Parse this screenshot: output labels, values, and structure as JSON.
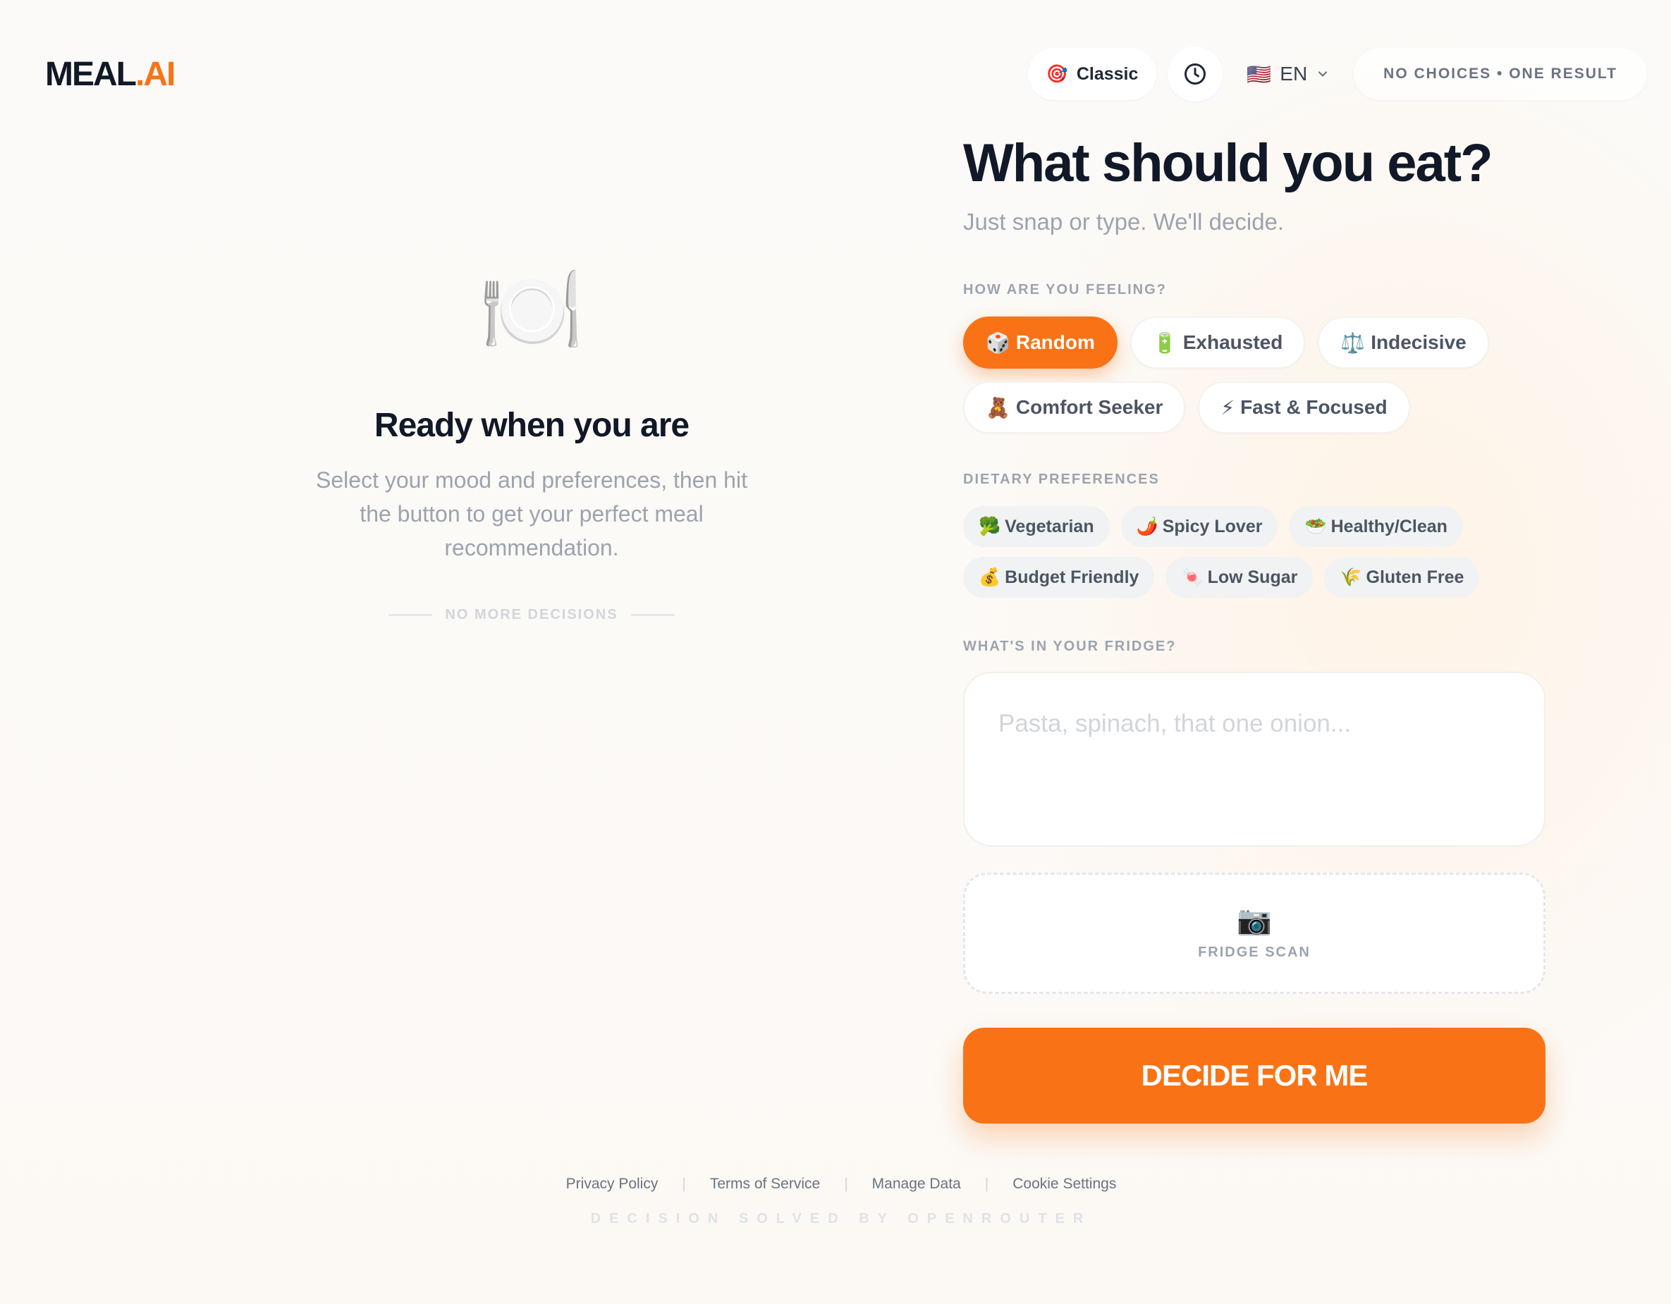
{
  "brand": {
    "name_main": "MEAL",
    "name_dot_ai": ".AI"
  },
  "header": {
    "mode": {
      "icon": "🎯",
      "label": "Classic"
    },
    "history_icon": "clock-icon",
    "language": {
      "flag": "🇺🇸",
      "code": "EN"
    },
    "tagline": "NO CHOICES • ONE RESULT"
  },
  "empty_state": {
    "icon": "🍽️",
    "title": "Ready when you are",
    "description": "Select your mood and preferences, then hit the button to get your perfect meal recommendation.",
    "divider_text": "NO MORE DECISIONS"
  },
  "form": {
    "title": "What should you eat?",
    "subtitle": "Just snap or type. We'll decide.",
    "mood_label": "HOW ARE YOU FEELING?",
    "moods": [
      {
        "icon": "🎲",
        "label": "Random",
        "selected": true
      },
      {
        "icon": "🔋",
        "label": "Exhausted",
        "selected": false
      },
      {
        "icon": "⚖️",
        "label": "Indecisive",
        "selected": false
      },
      {
        "icon": "🧸",
        "label": "Comfort Seeker",
        "selected": false
      },
      {
        "icon": "⚡",
        "label": "Fast & Focused",
        "selected": false
      }
    ],
    "dietary_label": "DIETARY PREFERENCES",
    "dietary": [
      {
        "icon": "🥦",
        "label": "Vegetarian"
      },
      {
        "icon": "🌶️",
        "label": "Spicy Lover"
      },
      {
        "icon": "🥗",
        "label": "Healthy/Clean"
      },
      {
        "icon": "💰",
        "label": "Budget Friendly"
      },
      {
        "icon": "🍬",
        "label": "Low Sugar"
      },
      {
        "icon": "🌾",
        "label": "Gluten Free"
      }
    ],
    "fridge_label": "WHAT'S IN YOUR FRIDGE?",
    "fridge_value": "",
    "fridge_placeholder": "Pasta, spinach, that one onion...",
    "scan": {
      "icon": "📷",
      "label": "FRIDGE SCAN"
    },
    "submit_label": "DECIDE FOR ME"
  },
  "footer": {
    "links": [
      "Privacy Policy",
      "Terms of Service",
      "Manage Data",
      "Cookie Settings"
    ],
    "credit": "DECISION SOLVED BY OPENROUTER"
  },
  "colors": {
    "accent": "#f97316",
    "text_dark": "#111827",
    "muted": "#9ca3af"
  }
}
